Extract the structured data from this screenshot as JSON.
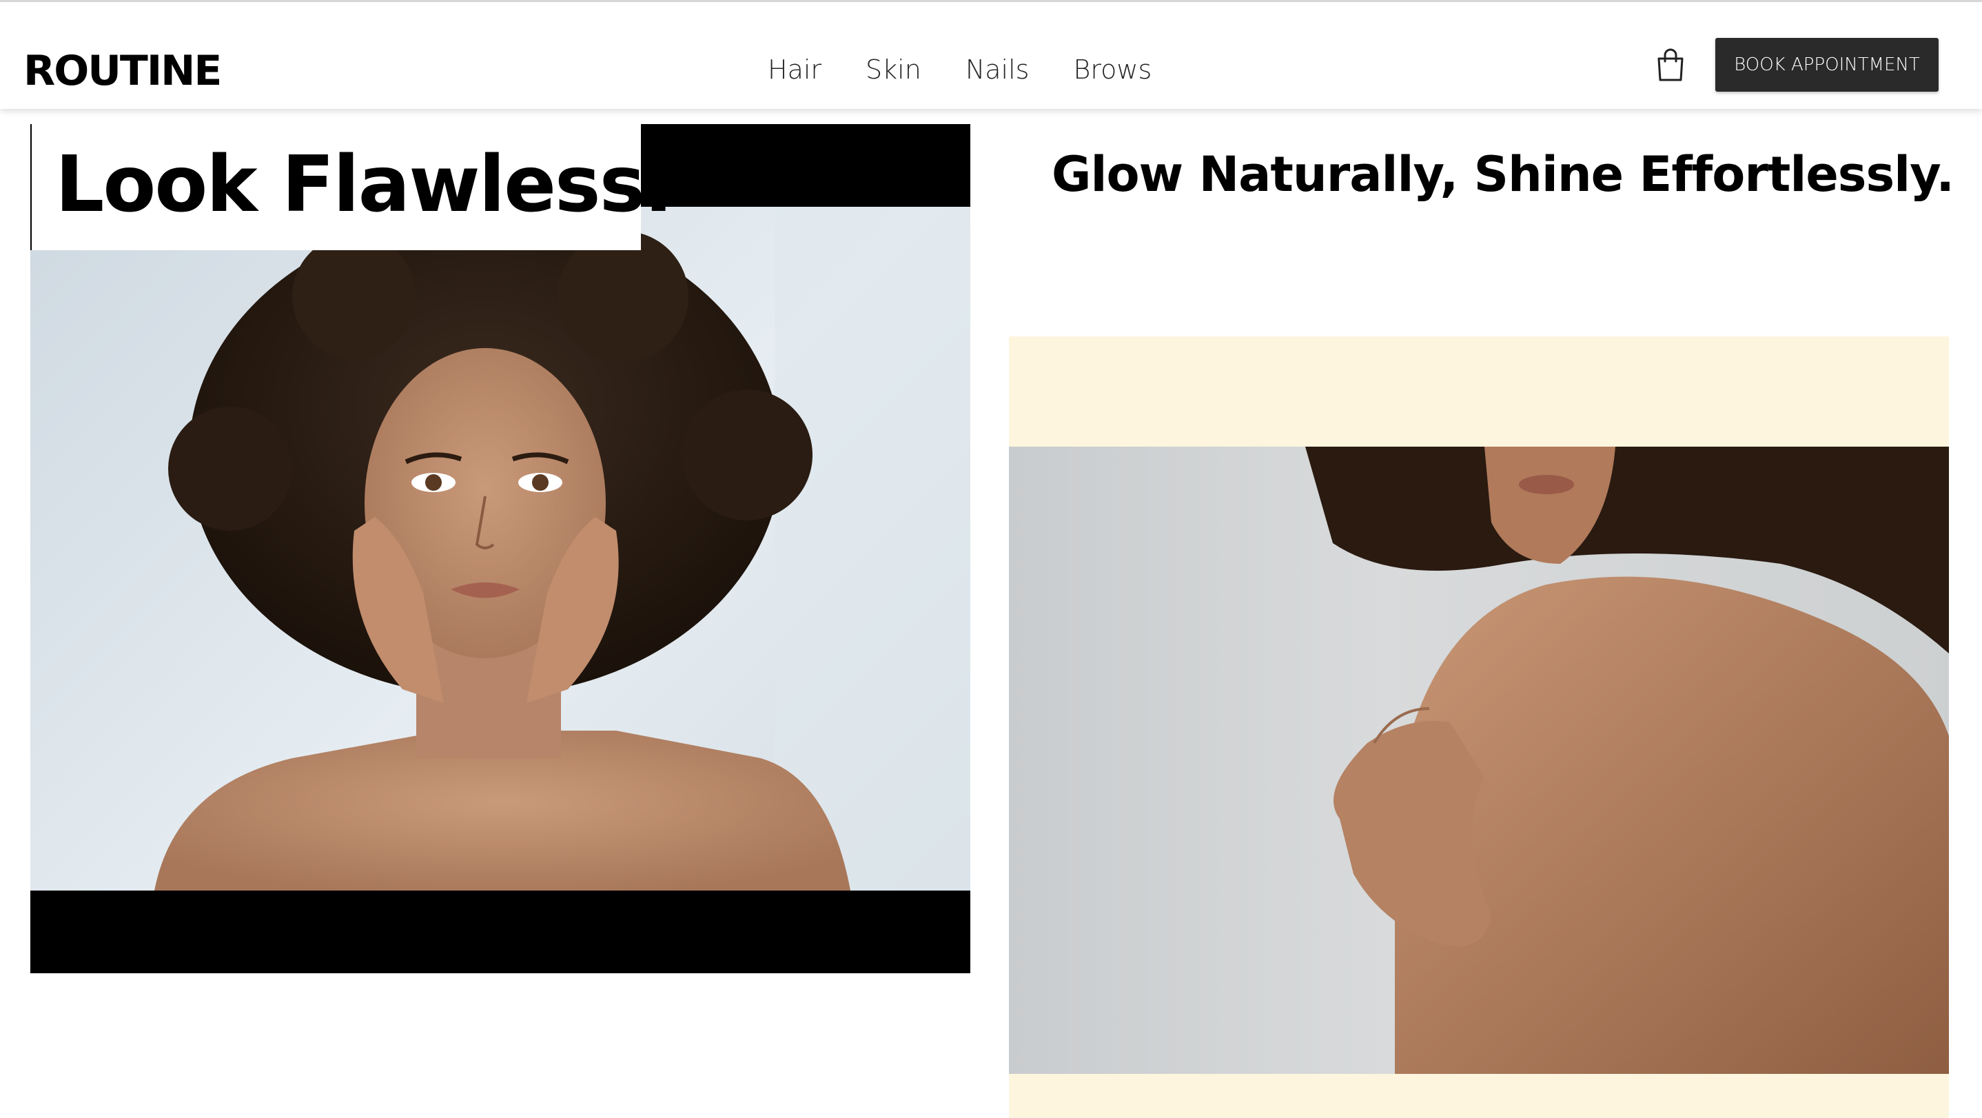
{
  "header": {
    "logo_text": "ROUTINE",
    "nav": [
      {
        "label": "Hair"
      },
      {
        "label": "Skin"
      },
      {
        "label": "Nails"
      },
      {
        "label": "Brows"
      }
    ],
    "cart_icon": "shopping-bag-icon",
    "cta_label": "BOOK APPOINTMENT"
  },
  "hero": {
    "left_title": "Look Flawless.",
    "right_title": "Glow Naturally,  Shine Effortlessly."
  },
  "colors": {
    "cta_bg": "#2a2a2a",
    "cream": "#fdf5de",
    "black": "#000000"
  }
}
